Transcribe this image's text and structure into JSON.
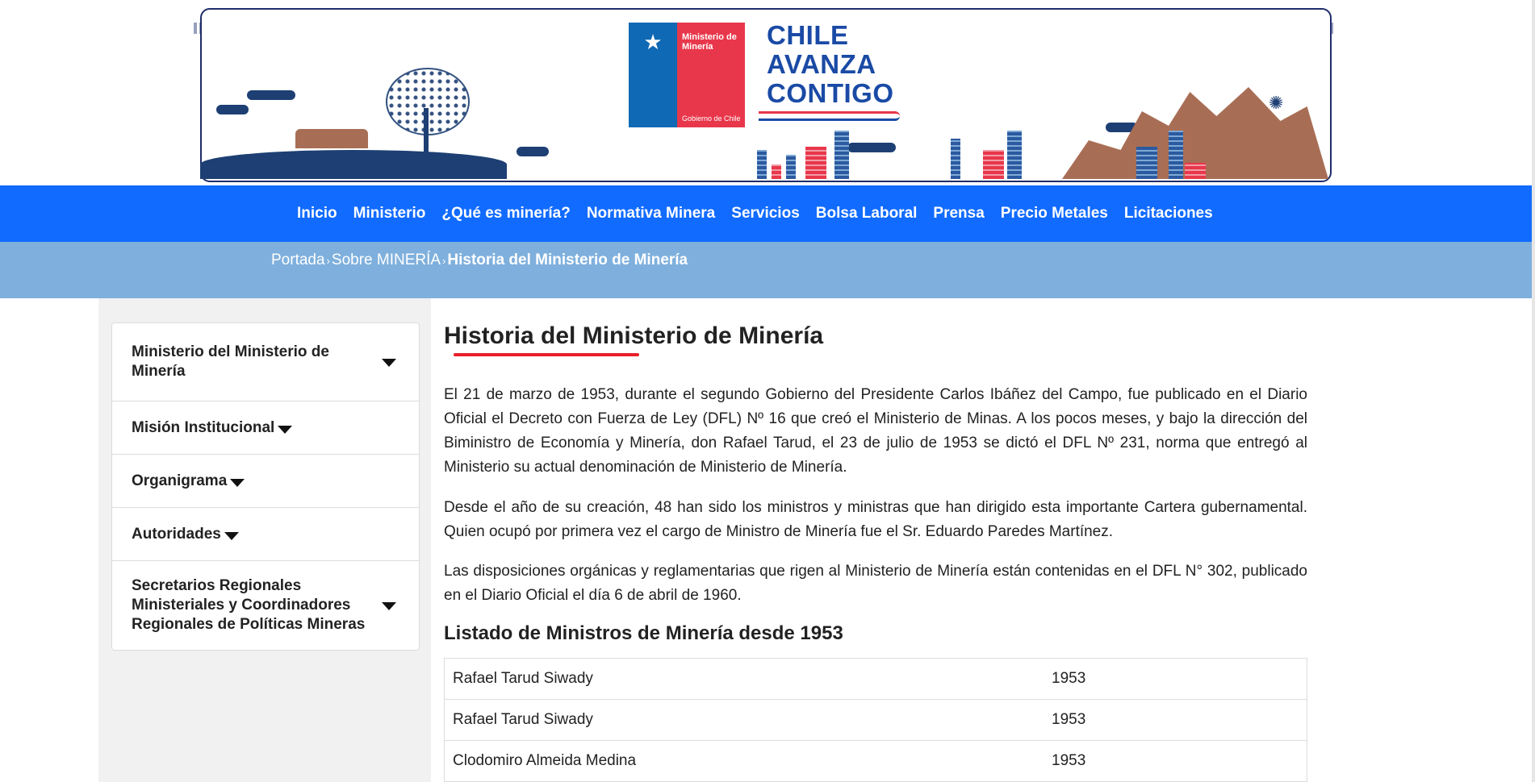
{
  "banner": {
    "logo_ministry": "Ministerio de Minería",
    "logo_government": "Gobierno de Chile",
    "slogan_lines": [
      "CHILE",
      "AVANZA",
      "CONTIGO"
    ]
  },
  "nav": {
    "items": [
      "Inicio",
      "Ministerio",
      "¿Qué es minería?",
      "Normativa Minera",
      "Servicios",
      "Bolsa Laboral",
      "Prensa",
      "Precio Metales",
      "Licitaciones"
    ]
  },
  "breadcrumb": {
    "items": [
      "Portada",
      "Sobre MINERÍA"
    ],
    "current": "Historia del Ministerio de Minería",
    "separator": "›"
  },
  "sidebar": {
    "items": [
      {
        "label": "Ministerio del Ministerio de Minería"
      },
      {
        "label": "Misión Institucional"
      },
      {
        "label": "Organigrama"
      },
      {
        "label": "Autoridades"
      },
      {
        "label": "Secretarios Regionales Ministeriales y Coordinadores Regionales de Políticas Mineras"
      }
    ]
  },
  "main": {
    "title": "Historia del Ministerio de Minería",
    "paragraphs": [
      "El 21 de marzo de 1953, durante el segundo Gobierno del Presidente Carlos Ibáñez del Campo, fue publicado en el Diario Oficial el Decreto con Fuerza de Ley (DFL) Nº 16 que creó el Ministerio de Minas. A los pocos meses, y bajo la dirección del Biministro de Economía y Minería, don Rafael Tarud, el 23 de julio de 1953 se dictó el DFL Nº 231, norma que entregó al Ministerio su actual denominación de Ministerio de Minería.",
      "Desde el año de su creación, 48 han sido los ministros y ministras que han dirigido esta importante Cartera gubernamental. Quien ocupó por primera vez el cargo de Ministro de Minería fue el Sr. Eduardo Paredes Martínez.",
      "Las disposiciones orgánicas y reglamentarias que rigen al Ministerio de Minería están contenidas en el DFL N° 302, publicado en el Diario Oficial el día 6 de abril de 1960."
    ],
    "subtitle": "Listado de Ministros de Minería desde 1953",
    "ministers": [
      {
        "name": "Rafael Tarud Siwady",
        "year": "1953"
      },
      {
        "name": "Rafael Tarud Siwady",
        "year": "1953"
      },
      {
        "name": "Clodomiro Almeida Medina",
        "year": "1953"
      }
    ]
  },
  "colors": {
    "nav_bg": "#116bff",
    "breadcrumb_bg": "#7fb0dd",
    "accent_red": "#e8202a",
    "brand_blue": "#1a4aa5"
  }
}
